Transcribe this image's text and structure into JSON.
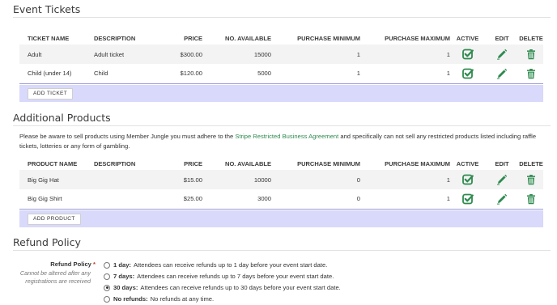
{
  "tickets": {
    "title": "Event Tickets",
    "headers": [
      "TICKET NAME",
      "DESCRIPTION",
      "PRICE",
      "NO. AVAILABLE",
      "PURCHASE MINIMUM",
      "PURCHASE MAXIMUM",
      "ACTIVE",
      "EDIT",
      "DELETE"
    ],
    "rows": [
      {
        "name": "Adult",
        "description": "Adult ticket",
        "price": "$300.00",
        "available": "15000",
        "min": "1",
        "max": "1"
      },
      {
        "name": "Child (under 14)",
        "description": "Child",
        "price": "$120.00",
        "available": "5000",
        "min": "1",
        "max": "1"
      }
    ],
    "add_label": "ADD TICKET"
  },
  "products": {
    "title": "Additional Products",
    "notice_before": "Please be aware to sell products using Member Jungle you must adhere to the ",
    "notice_link": "Stripe Restricted Business Agreement",
    "notice_after": " and specifically can not sell any restricted products listed including raffle tickets, lotteries or any form of gambling.",
    "headers": [
      "PRODUCT NAME",
      "DESCRIPTION",
      "PRICE",
      "NO. AVAILABLE",
      "PURCHASE MINIMUM",
      "PURCHASE MAXIMUM",
      "ACTIVE",
      "EDIT",
      "DELETE"
    ],
    "rows": [
      {
        "name": "Big Gig Hat",
        "description": "",
        "price": "$15.00",
        "available": "10000",
        "min": "0",
        "max": "1"
      },
      {
        "name": "Big Gig Shirt",
        "description": "",
        "price": "$25.00",
        "available": "3000",
        "min": "0",
        "max": "1"
      }
    ],
    "add_label": "ADD PRODUCT"
  },
  "refund": {
    "title": "Refund Policy",
    "label": "Refund Policy",
    "required_mark": "*",
    "help": "Cannot be altered after any registrations are received",
    "options": [
      {
        "key": "1 day:",
        "text": "Attendees can receive refunds up to 1 day before your event start date.",
        "checked": false
      },
      {
        "key": "7 days:",
        "text": "Attendees can receive refunds up to 7 days before your event start date.",
        "checked": false
      },
      {
        "key": "30 days:",
        "text": "Attendees can receive refunds up to 30 days before your event start date.",
        "checked": true
      },
      {
        "key": "No refunds:",
        "text": "No refunds at any time.",
        "checked": false
      }
    ]
  },
  "colors": {
    "accent_green": "#2e8a4f",
    "add_bar": "#d9d9fb",
    "row_alt": "#f3f3f3"
  },
  "icons": {
    "active": "check-square-icon",
    "edit": "pencil-icon",
    "delete": "trash-icon"
  }
}
